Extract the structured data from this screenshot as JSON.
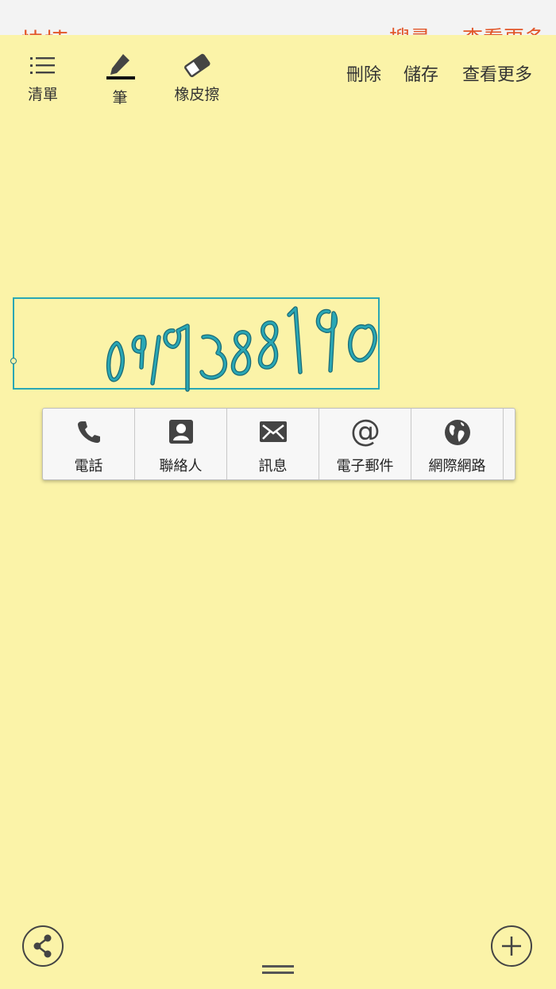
{
  "background_app": {
    "title": "快捷 memo",
    "right_items": [
      "搜尋",
      "查看更多"
    ]
  },
  "toolbar": {
    "list_label": "清單",
    "pen_label": "筆",
    "eraser_label": "橡皮擦",
    "delete_label": "刪除",
    "save_label": "儲存",
    "more_label": "查看更多"
  },
  "handwriting": {
    "text": "0917388190",
    "color": "#29a7b5"
  },
  "popup": {
    "items": [
      {
        "icon": "phone-icon",
        "label": "電話"
      },
      {
        "icon": "contact-icon",
        "label": "聯絡人"
      },
      {
        "icon": "message-icon",
        "label": "訊息"
      },
      {
        "icon": "email-icon",
        "label": "電子郵件"
      },
      {
        "icon": "globe-icon",
        "label": "網際網路"
      }
    ]
  },
  "colors": {
    "memo_bg": "#fbf3a8",
    "accent": "#e2572a",
    "stroke": "#29a7b5"
  }
}
